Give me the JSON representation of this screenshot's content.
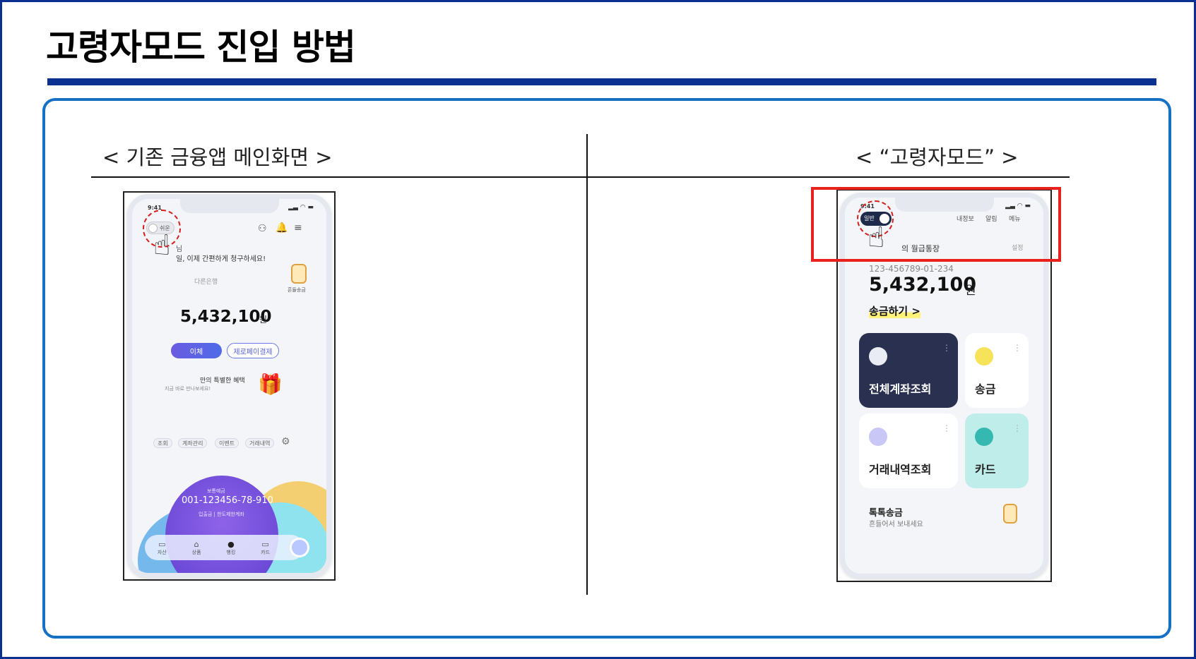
{
  "slide": {
    "title": "고령자모드 진입 방법",
    "caption_left": "< 기존 금융앱 메인화면 >",
    "caption_right": "< “고령자모드” >"
  },
  "left_phone": {
    "status_time": "9:41",
    "toggle_label": "쉬운",
    "greeting_partial": "님",
    "greeting": "일, 이제 간편하게 청구하세요!",
    "bank_name": "다른은행",
    "shake_label": "흔들송금",
    "balance": "5,432,100",
    "currency": "원",
    "transfer_button": "이체",
    "zeropay_button": "제로페이결제",
    "promo_title": "만의 특별한 혜택",
    "promo_sub": "지금 바로 만나보세요!",
    "chips": [
      "조회",
      "계좌관리",
      "이벤트",
      "거래내역"
    ],
    "card_label": "보통예금",
    "account_number": "001-123456-78-910",
    "card_actions": "입출금 | 한도제한계좌",
    "tabs": [
      "자산",
      "상품",
      "뱅킹",
      "카드"
    ]
  },
  "right_phone": {
    "status_time": "9:41",
    "toggle_label": "일반",
    "header_links": [
      "내정보",
      "알림",
      "메뉴"
    ],
    "account_title": "의 월급통장",
    "account_settings": "설정",
    "account_number": "123-456789-01-234",
    "balance": "5,432,100",
    "currency": "원",
    "transfer_link": "송금하기 >",
    "tiles": [
      {
        "label": "전체계좌조회",
        "dark": true
      },
      {
        "label": "송금",
        "dark": false
      },
      {
        "label": "거래내역조회",
        "dark": false
      },
      {
        "label": "카드",
        "dark": false
      }
    ],
    "shake_title": "톡톡송금",
    "shake_sub": "흔들어서 보내세요"
  },
  "colors": {
    "title_rule": "#0a3191",
    "panel_border": "#1671c4",
    "highlight": "#e8201e",
    "dark_tile": "#2a3150",
    "mint_tile": "#bfeeea",
    "accent_purple": "#6b5be0"
  }
}
